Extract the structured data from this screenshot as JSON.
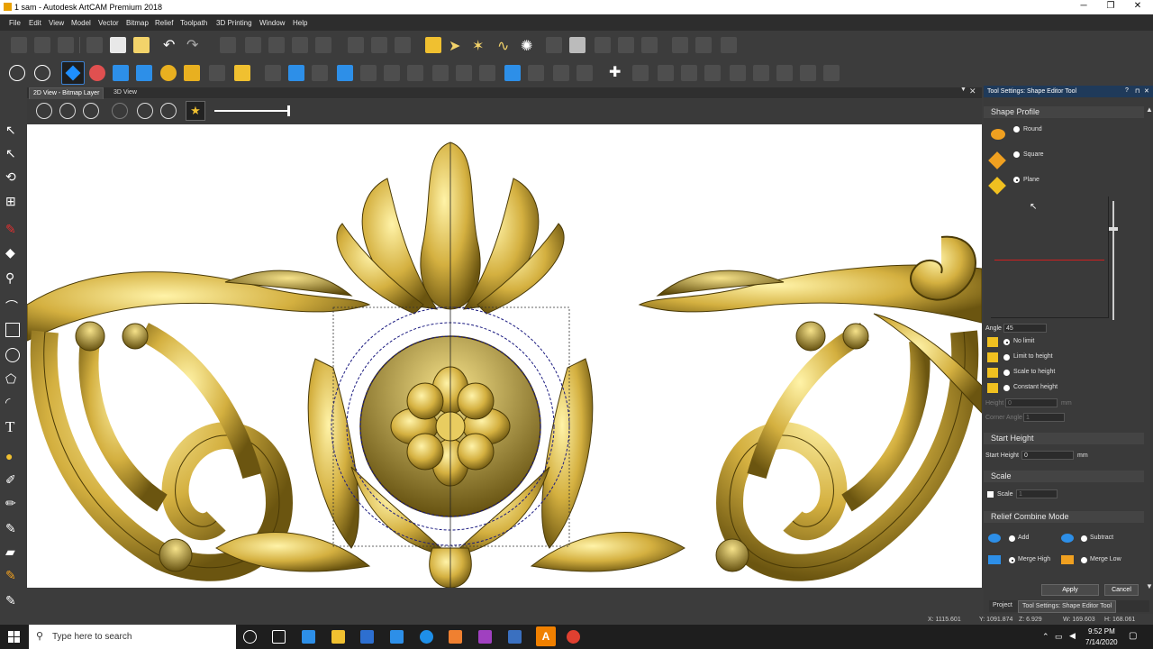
{
  "window": {
    "title": "1 sam - Autodesk ArtCAM Premium 2018"
  },
  "menu": [
    "File",
    "Edit",
    "View",
    "Model",
    "Vector",
    "Bitmap",
    "Relief",
    "Toolpath",
    "3D Printing",
    "Window",
    "Help"
  ],
  "view_tabs": [
    "2D View - Bitmap Layer",
    "3D View"
  ],
  "panel": {
    "title": "Tool Settings: Shape Editor Tool",
    "shape_profile": {
      "heading": "Shape Profile",
      "options": [
        "Round",
        "Square",
        "Plane"
      ],
      "selected": "Plane"
    },
    "angle": {
      "label": "Angle",
      "value": "45"
    },
    "height_modes": {
      "options": [
        "No limit",
        "Limit to height",
        "Scale to height",
        "Constant height"
      ],
      "selected": "No limit"
    },
    "height": {
      "label": "Height",
      "value": "0",
      "unit": "mm"
    },
    "corner_angle": {
      "label": "Corner Angle",
      "value": "1"
    },
    "start_height": {
      "heading": "Start Height",
      "label": "Start Height",
      "value": "0",
      "unit": "mm"
    },
    "scale": {
      "heading": "Scale",
      "label": "Scale",
      "value": "1"
    },
    "combine": {
      "heading": "Relief Combine Mode",
      "options": [
        "Add",
        "Subtract",
        "Merge High",
        "Merge Low"
      ],
      "selected": "Merge High"
    },
    "apply": "Apply",
    "cancel": "Cancel",
    "bottom_tabs": [
      "Project",
      "Tool Settings: Shape Editor Tool"
    ]
  },
  "status": {
    "x": "X: 1115.601",
    "y": "Y: 1091.874",
    "z": "Z: 6.929",
    "w": "W: 169.603",
    "h": "H: 168.061"
  },
  "taskbar": {
    "search_placeholder": "Type here to search",
    "time": "9:52 PM",
    "date": "7/14/2020"
  },
  "colors": {
    "gold": "#c9a227",
    "panel": "#3a3a3a",
    "accent": "#1f3a5a"
  }
}
